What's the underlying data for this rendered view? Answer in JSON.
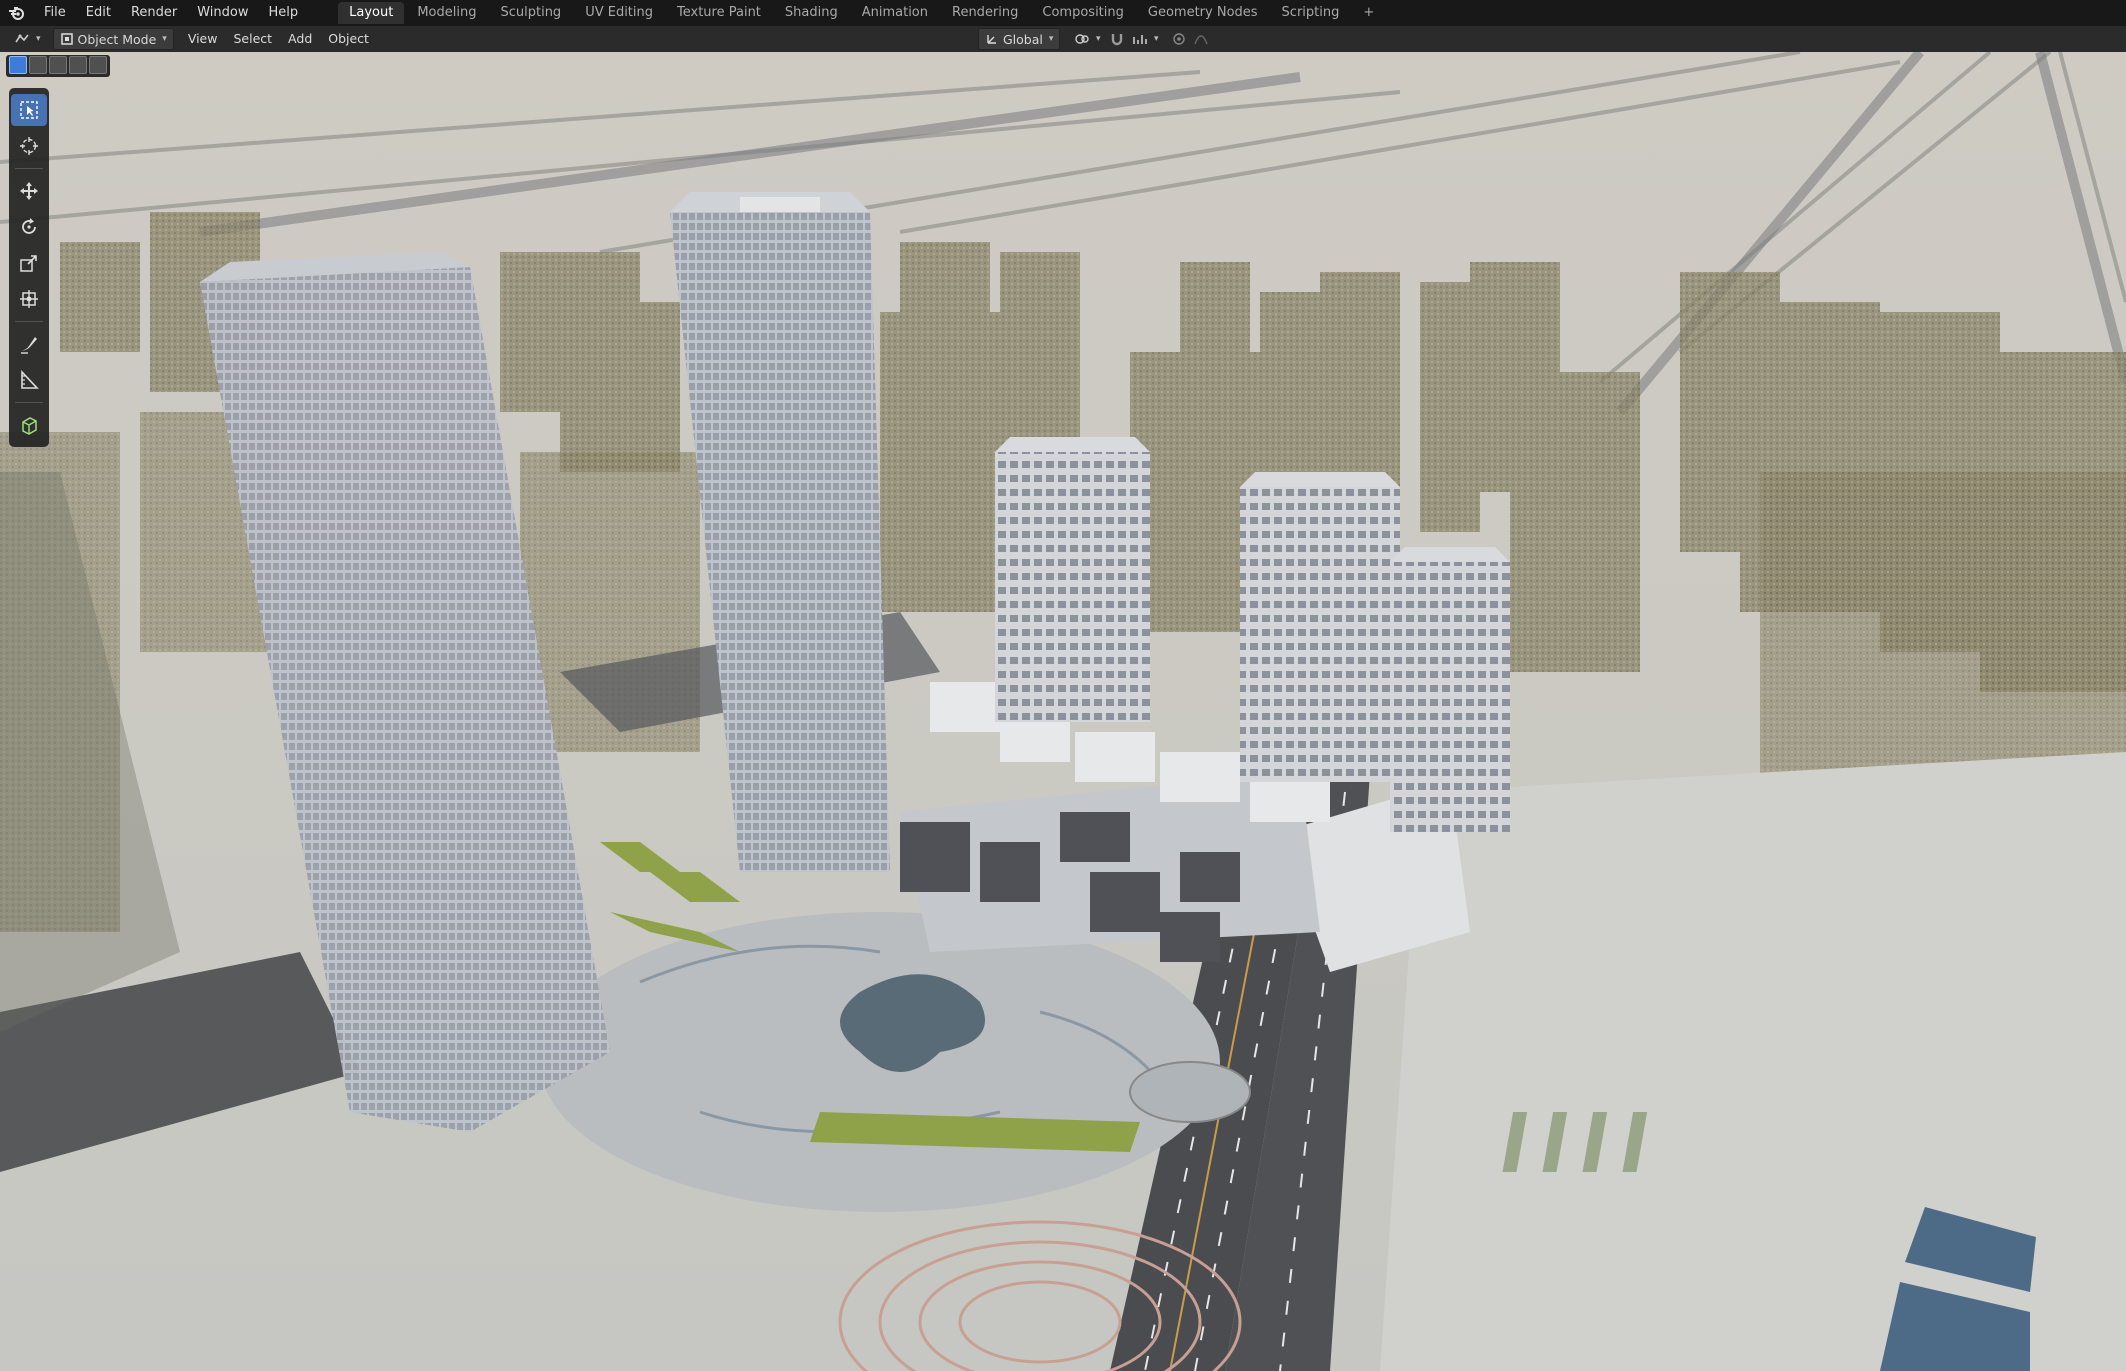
{
  "topbar": {
    "menus": [
      "File",
      "Edit",
      "Render",
      "Window",
      "Help"
    ],
    "tabs": [
      "Layout",
      "Modeling",
      "Sculpting",
      "UV Editing",
      "Texture Paint",
      "Shading",
      "Animation",
      "Rendering",
      "Compositing",
      "Geometry Nodes",
      "Scripting"
    ],
    "active_tab": "Layout",
    "add_tab": "+"
  },
  "header": {
    "mode": "Object Mode",
    "menus": [
      "View",
      "Select",
      "Add",
      "Object"
    ],
    "transform_orientation": "Global"
  },
  "toolbar": {
    "tools": [
      "select-box-icon",
      "cursor-icon",
      "move-icon",
      "rotate-icon",
      "scale-icon",
      "transform-icon",
      "annotate-icon",
      "measure-icon",
      "add-cube-icon"
    ],
    "active_tool": "select-box-icon"
  },
  "colors": {
    "topbar_bg": "#181818",
    "header_bg": "#2b2b2b",
    "accent": "#4772b3",
    "ground": "#c8c9c4",
    "road": "#4a4c50",
    "greenery": "#8fa24a"
  }
}
